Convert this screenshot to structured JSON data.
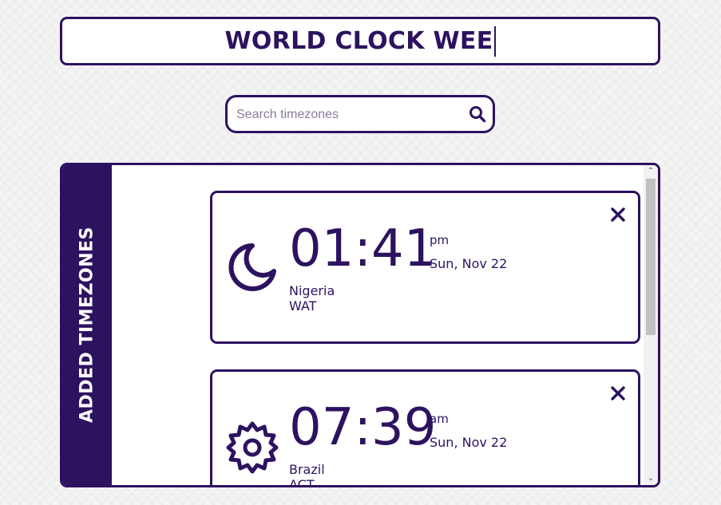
{
  "app": {
    "title": "WORLD CLOCK WEE"
  },
  "search": {
    "placeholder": "Search timezones",
    "value": "",
    "icon": "search-icon"
  },
  "panel": {
    "label": "ADDED TIMEZONES",
    "scroll_up": "⌃",
    "scroll_down": "⌄"
  },
  "timezones": [
    {
      "time": "01:41",
      "ampm": "pm",
      "date": "Sun, Nov 22",
      "country": "Nigeria",
      "abbr": "WAT",
      "icon": "moon-icon"
    },
    {
      "time": "07:39",
      "ampm": "am",
      "date": "Sun, Nov 22",
      "country": "Brazil",
      "abbr": "ACT",
      "icon": "sun-icon"
    }
  ],
  "colors": {
    "accent": "#2d1260",
    "background": "#f4f4f4",
    "card": "#ffffff"
  }
}
